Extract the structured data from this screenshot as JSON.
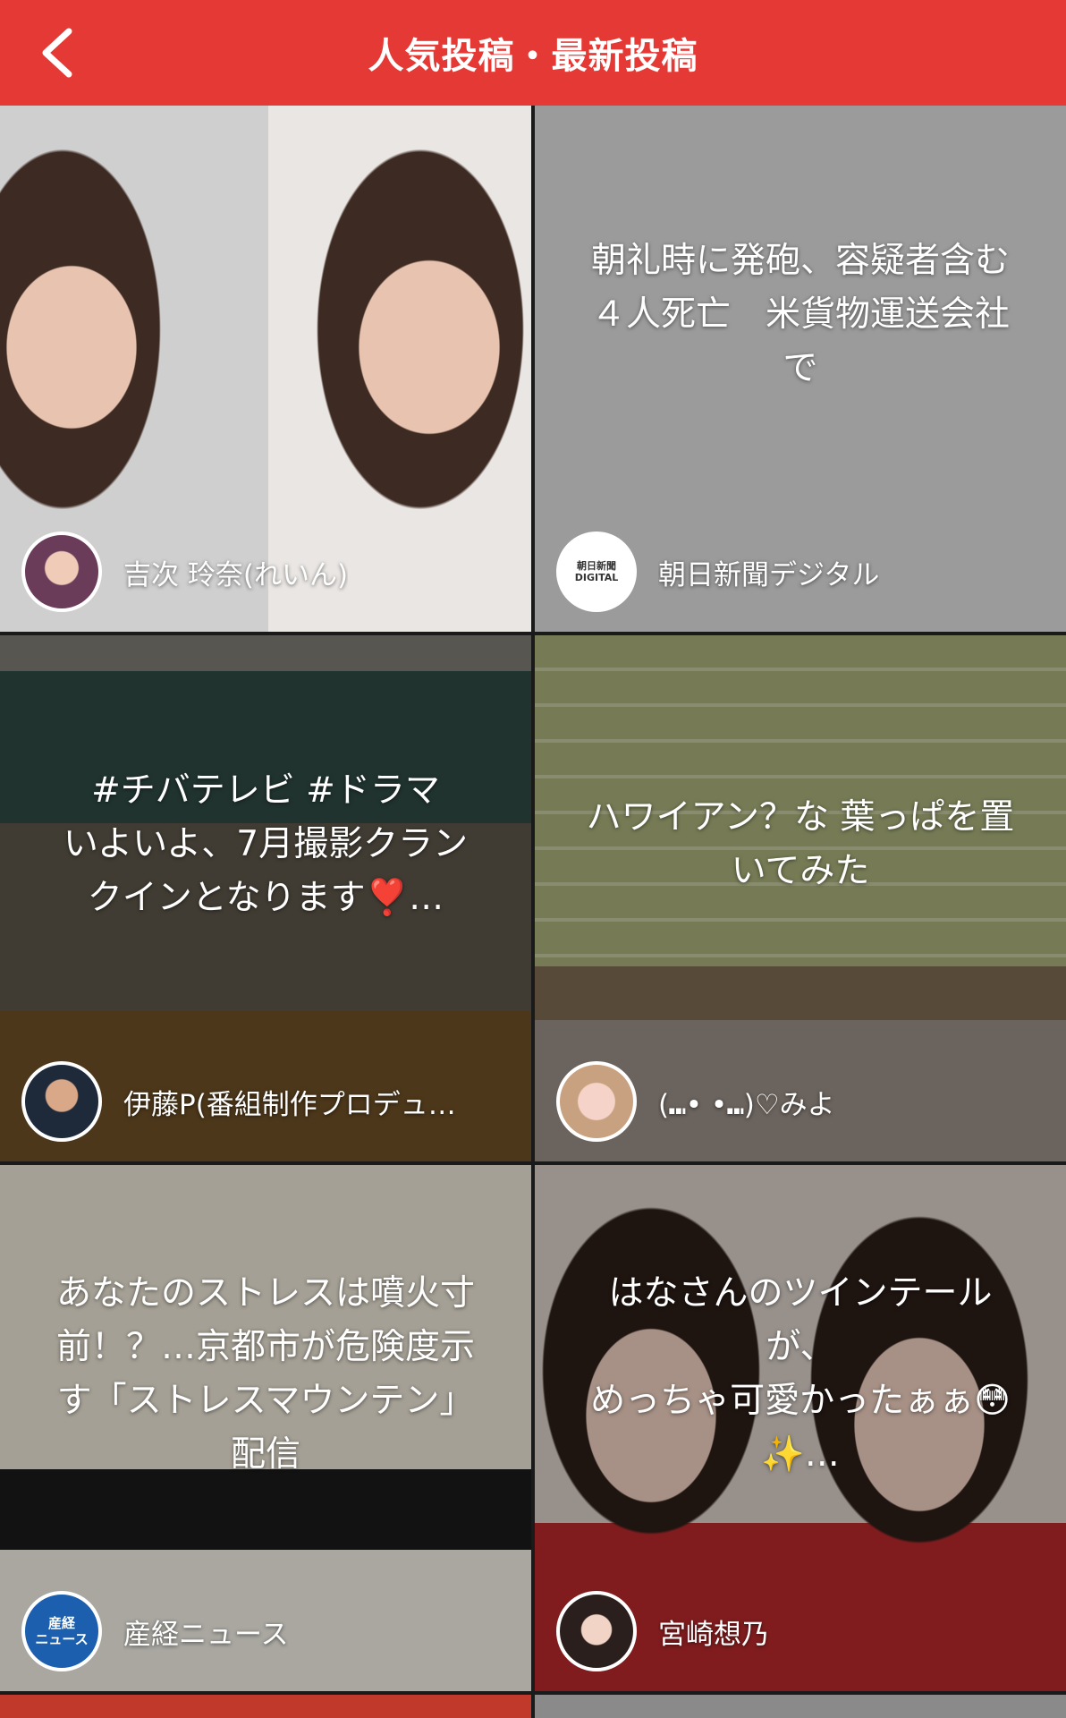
{
  "header": {
    "title": "人気投稿・最新投稿",
    "back_icon": "chevron-left-icon",
    "color": "#e53935"
  },
  "tiles": [
    {
      "caption": "",
      "author": "吉次 玲奈(れいん)"
    },
    {
      "caption": "朝礼時に発砲、容疑者含む\n４人死亡　米貨物運送会社\nで",
      "author": "朝日新聞デジタル",
      "avatar_text": "朝日新聞\nDIGITAL"
    },
    {
      "caption": "#チバテレビ #ドラマ\nいよいよ、7月撮影クラン\nクインとなります❣️…",
      "author": "伊藤P(番組制作プロデュ…"
    },
    {
      "caption": "ハワイアン？な 葉っぱを置\nいてみた",
      "author": "(⑉• •⑉)♡みよ"
    },
    {
      "caption": "あなたのストレスは噴火寸\n前！？…京都市が危険度示\nす「ストレスマウンテン」\n配信",
      "author": "産経ニュース",
      "avatar_text": "産経\nニュース"
    },
    {
      "caption": "はなさんのツインテール\nが、\nめっちゃ可愛かったぁぁ😳\n✨…",
      "author": "宮崎想乃"
    }
  ]
}
